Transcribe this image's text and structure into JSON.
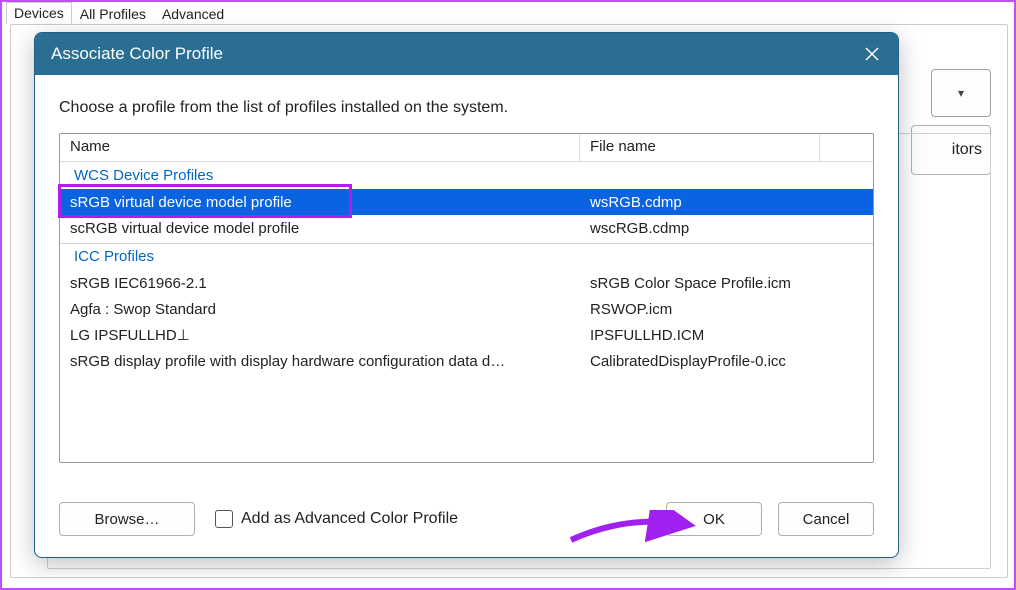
{
  "background": {
    "tabs": [
      "Devices",
      "All Profiles",
      "Advanced"
    ],
    "selected_tab": 0,
    "button_label": "itors"
  },
  "dialog": {
    "title": "Associate Color Profile",
    "instruction": "Choose a profile from the list of profiles installed on the system.",
    "columns": {
      "name": "Name",
      "file": "File name"
    },
    "groups": [
      {
        "label": "WCS Device Profiles",
        "rows": [
          {
            "name": "sRGB virtual device model profile",
            "file": "wsRGB.cdmp",
            "selected": true
          },
          {
            "name": "scRGB virtual device model profile",
            "file": "wscRGB.cdmp",
            "selected": false
          }
        ]
      },
      {
        "label": "ICC Profiles",
        "rows": [
          {
            "name": "sRGB IEC61966-2.1",
            "file": "sRGB Color Space Profile.icm",
            "selected": false
          },
          {
            "name": "Agfa : Swop Standard",
            "file": "RSWOP.icm",
            "selected": false
          },
          {
            "name": "LG IPSFULLHD⊥",
            "file": "IPSFULLHD.ICM",
            "selected": false
          },
          {
            "name": "sRGB display profile with display hardware configuration data d…",
            "file": "CalibratedDisplayProfile-0.icc",
            "selected": false
          }
        ]
      }
    ],
    "footer": {
      "browse": "Browse…",
      "checkbox_label": "Add as Advanced Color Profile",
      "checkbox_checked": false,
      "ok": "OK",
      "cancel": "Cancel"
    }
  },
  "annotation": {
    "highlight_color": "#b01fea",
    "arrow_color": "#a020f0"
  }
}
